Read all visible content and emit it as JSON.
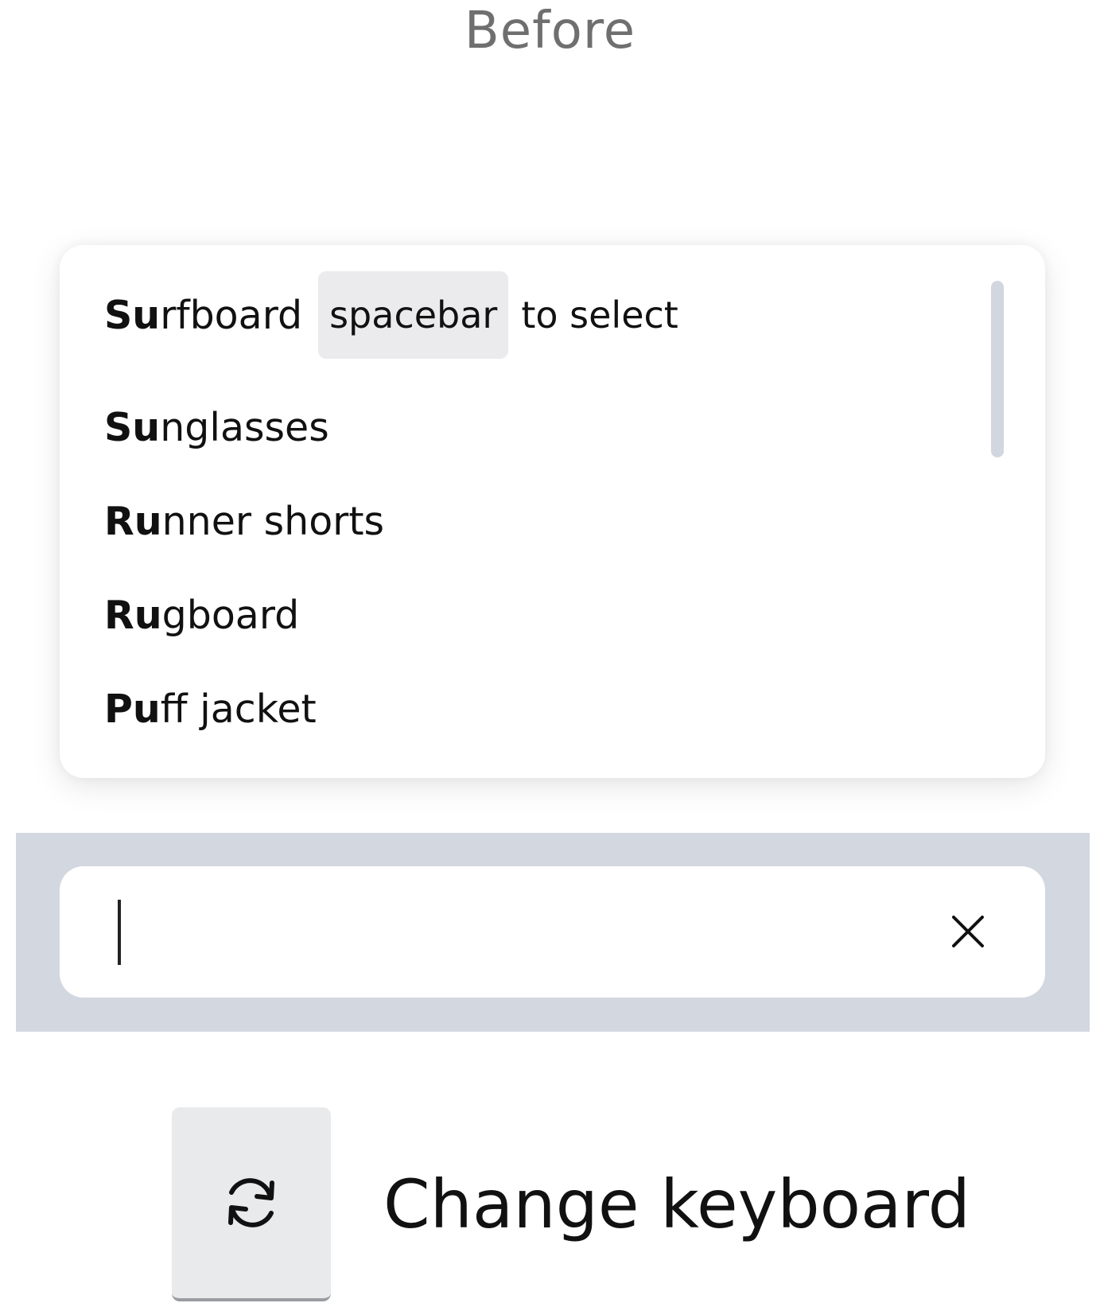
{
  "page": {
    "heading": "Before"
  },
  "dropdown": {
    "options": [
      {
        "match": "Su",
        "rest": "rfboard",
        "highlighted": true
      },
      {
        "match": "Su",
        "rest": "nglasses"
      },
      {
        "match": "Ru",
        "rest": "nner shorts"
      },
      {
        "match": "Ru",
        "rest": "gboard"
      },
      {
        "match": "Pu",
        "rest": "ff jacket"
      }
    ],
    "hint": {
      "key": "spacebar",
      "text": "to select"
    }
  },
  "search": {
    "value": "",
    "placeholder": "",
    "clear_icon": "close-icon"
  },
  "keyboard": {
    "label": "Change keyboard",
    "icon": "refresh-icon"
  },
  "colors": {
    "heading": "#6f6f6f",
    "band": "#d3d7e0",
    "hint_key_bg": "#ebebed",
    "scroll_thumb": "#d1d6df",
    "key_bg": "#e9eaec"
  }
}
